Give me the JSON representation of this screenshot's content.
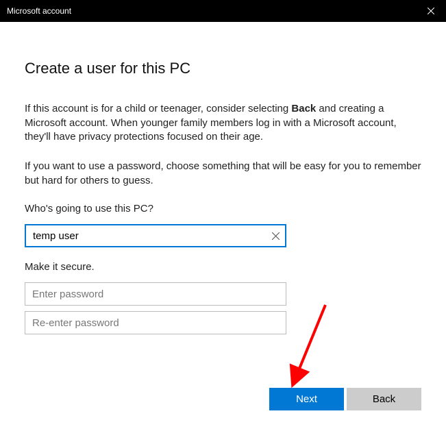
{
  "titlebar": {
    "title": "Microsoft account"
  },
  "heading": "Create a user for this PC",
  "intro_para_pre": "If this account is for a child or teenager, consider selecting ",
  "intro_para_bold": "Back",
  "intro_para_post": " and creating a Microsoft account. When younger family members log in with a Microsoft account, they'll have privacy protections focused on their age.",
  "password_para": "If you want to use a password, choose something that will be easy for you to remember but hard for others to guess.",
  "user_label": "Who's going to use this PC?",
  "username_value": "temp user",
  "secure_label": "Make it secure.",
  "password_placeholder": "Enter password",
  "password_confirm_placeholder": "Re-enter password",
  "buttons": {
    "next": "Next",
    "back": "Back"
  },
  "colors": {
    "primary": "#0078d4",
    "arrow": "#ff0000"
  }
}
